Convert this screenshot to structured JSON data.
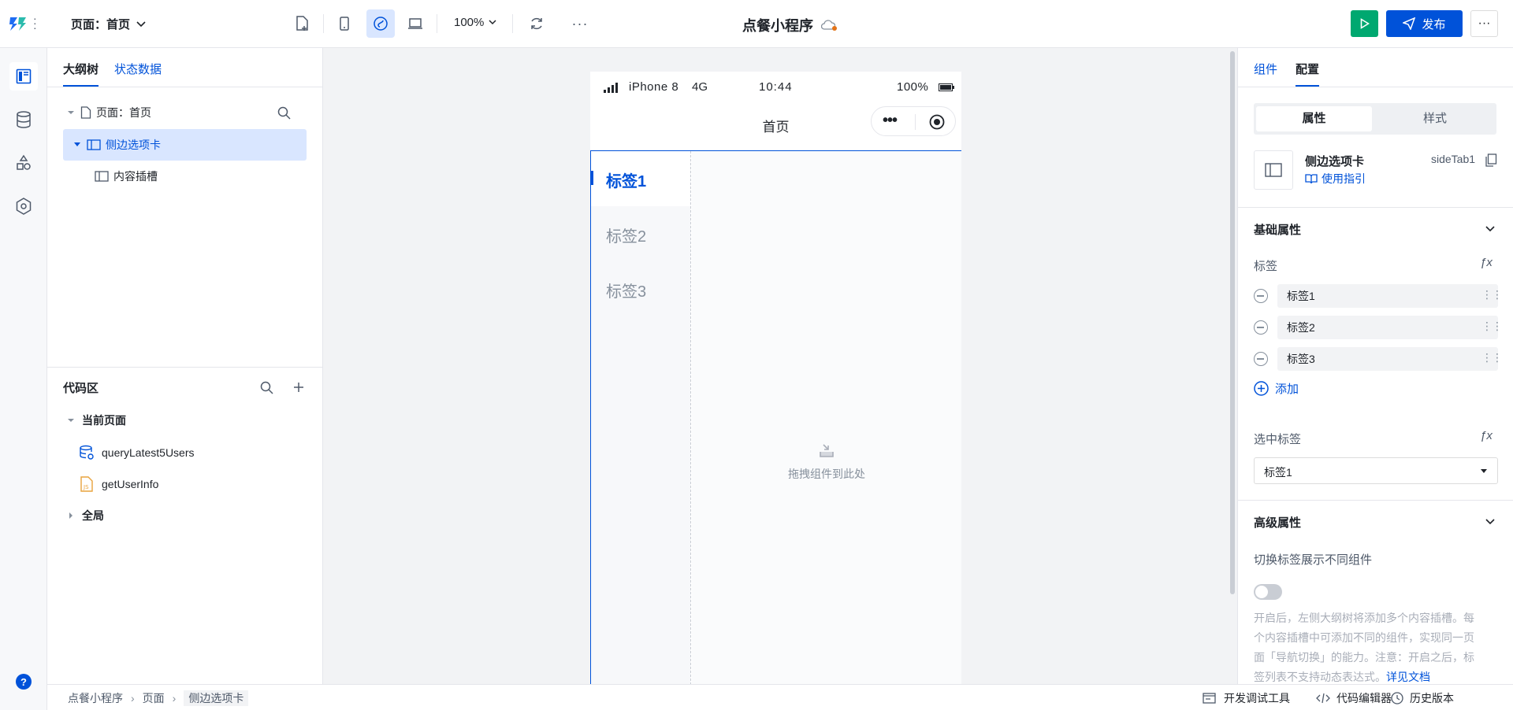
{
  "topbar": {
    "page_selector": "页面：首页",
    "zoom": "100%",
    "app_title": "点餐小程序",
    "publish_label": "发布"
  },
  "left_panel": {
    "tabs": [
      {
        "label": "大纲树"
      },
      {
        "label": "状态数据"
      }
    ],
    "tree": {
      "page_label": "页面：首页",
      "side_tab_label": "侧边选项卡",
      "slot_label": "内容插槽"
    },
    "code_area": {
      "title": "代码区",
      "current_page": "当前页面",
      "items": [
        {
          "label": "queryLatest5Users"
        },
        {
          "label": "getUserInfo"
        }
      ],
      "global": "全局"
    }
  },
  "phone": {
    "carrier": "iPhone 8",
    "network": "4G",
    "time": "10:44",
    "battery": "100%",
    "nav_title": "首页",
    "side_tabs": [
      {
        "label": "标签1"
      },
      {
        "label": "标签2"
      },
      {
        "label": "标签3"
      }
    ],
    "drop_hint": "拖拽组件到此处"
  },
  "right_panel": {
    "tabs": [
      {
        "label": "组件"
      },
      {
        "label": "配置"
      }
    ],
    "segment": [
      {
        "label": "属性"
      },
      {
        "label": "样式"
      }
    ],
    "component_name": "侧边选项卡",
    "component_id": "sideTab1",
    "guide_link": "使用指引",
    "basic_section": "基础属性",
    "tags_label": "标签",
    "tags": [
      {
        "value": "标签1"
      },
      {
        "value": "标签2"
      },
      {
        "value": "标签3"
      }
    ],
    "add_label": "添加",
    "selected_label": "选中标签",
    "selected_value": "标签1",
    "advanced_section": "高级属性",
    "toggle_label": "切换标签展示不同组件",
    "toggle_on": false,
    "help_text_lines": [
      "开启后，左侧大纲树将添加多个内容插槽。每",
      "个内容插槽中可添加不同的组件，实现同一页",
      "面「导航切换」的能力。注意：开启之后，标",
      "签列表不支持动态表达式。"
    ],
    "doc_link": "详见文档"
  },
  "footer": {
    "breadcrumb": [
      {
        "label": "点餐小程序"
      },
      {
        "label": "页面"
      },
      {
        "label": "侧边选项卡"
      }
    ],
    "dev_tools": "开发调试工具",
    "code_editor": "代码编辑器",
    "history": "历史版本"
  },
  "colors": {
    "accent": "#0052d9",
    "run_green": "#00a870"
  }
}
